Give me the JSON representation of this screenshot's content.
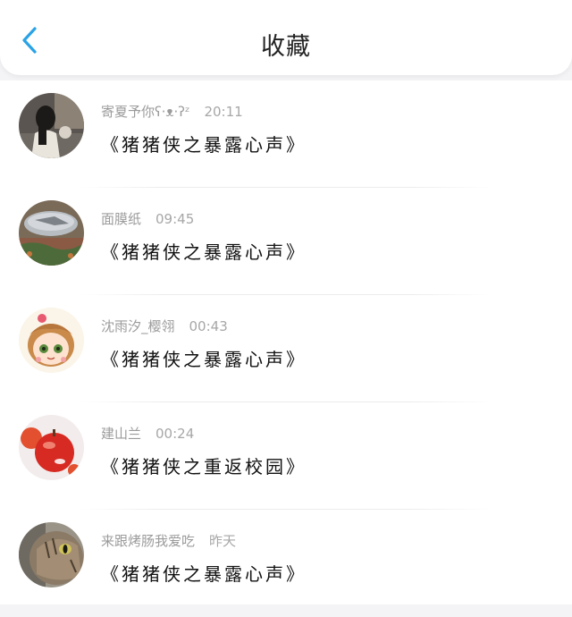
{
  "header": {
    "title": "收藏",
    "back_icon": "chevron-left-icon",
    "accent_color": "#2aa3e6"
  },
  "favorites": [
    {
      "nickname": "寄夏予你ʕ·ᴥ·ʔᶻ",
      "time": "20:11",
      "content": "《猪猪侠之暴露心声》"
    },
    {
      "nickname": "面膜纸",
      "time": "09:45",
      "content": "《猪猪侠之暴露心声》"
    },
    {
      "nickname": "沈雨汐_樱翎",
      "time": "00:43",
      "content": "《猪猪侠之暴露心声》"
    },
    {
      "nickname": "建山兰",
      "time": "00:24",
      "content": "《猪猪侠之重返校园》"
    },
    {
      "nickname": "来跟烤肠我爱吃",
      "time": "昨天",
      "content": "《猪猪侠之暴露心声》"
    }
  ]
}
